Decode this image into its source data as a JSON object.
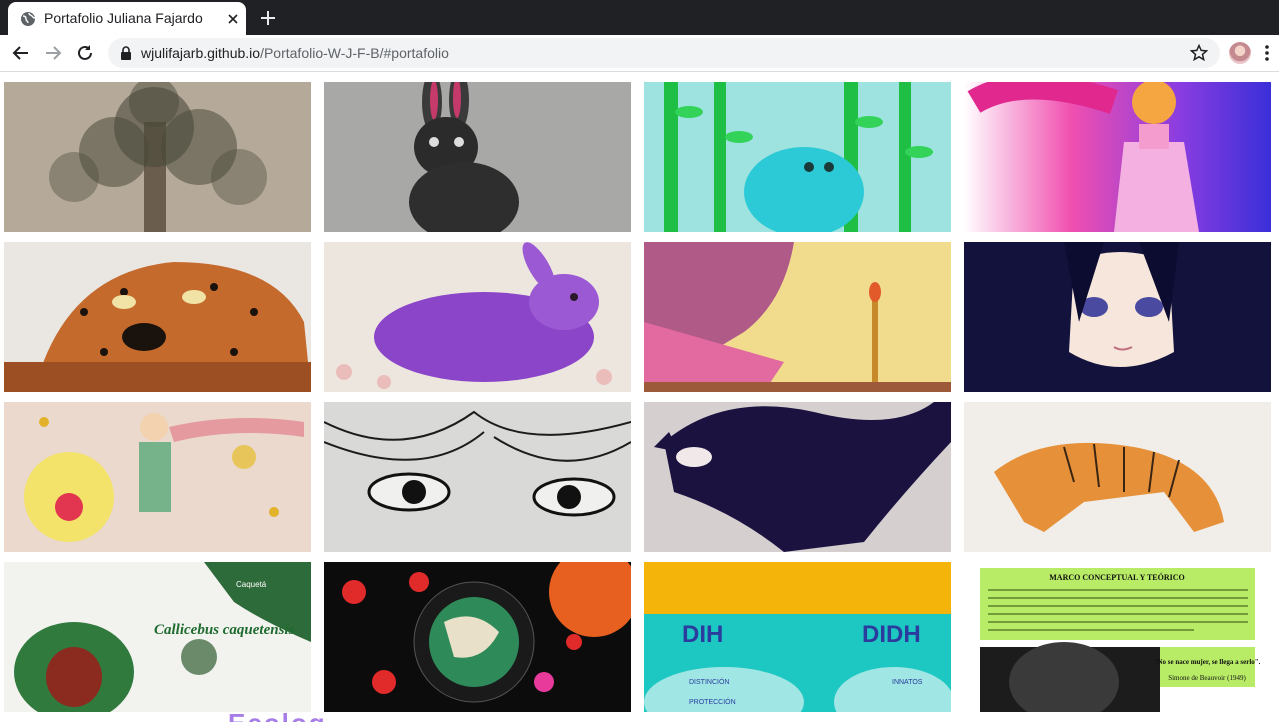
{
  "browser": {
    "tab_title": "Portafolio Juliana Fajardo",
    "url_domain": "wjulifajarb.github.io",
    "url_path": "/Portafolio-W-J-F-B/#portafolio"
  },
  "portfolio": {
    "items": [
      {
        "subject": "tree"
      },
      {
        "subject": "rabbit"
      },
      {
        "subject": "bamboo-creature"
      },
      {
        "subject": "sun-girl"
      },
      {
        "subject": "jaguar"
      },
      {
        "subject": "purple-rabbit"
      },
      {
        "subject": "girl-with-candle"
      },
      {
        "subject": "anime-girl"
      },
      {
        "subject": "little-prince"
      },
      {
        "subject": "eyes-sketch"
      },
      {
        "subject": "black-cat"
      },
      {
        "subject": "tiger"
      },
      {
        "subject": "callicebus-poster"
      },
      {
        "subject": "planets-infographic"
      },
      {
        "subject": "dih-didh-infographic"
      },
      {
        "subject": "marco-conceptual"
      }
    ],
    "callicebus": {
      "title": "Callicebus caquetensis",
      "map_label": "Caquetá"
    },
    "dih": {
      "left": "DIH",
      "right": "DIDH",
      "distincion": "DISTINCIÓN",
      "proteccion": "PROTECCIÓN",
      "innatos": "INNATOS"
    },
    "marco": {
      "title": "MARCO CONCEPTUAL Y TEÓRICO",
      "quote": "\"No se nace mujer, se llega a serlo\".",
      "quote_author": "Simone de Beauvoir (1949)"
    }
  },
  "section_heading_partial": "Ecolog"
}
